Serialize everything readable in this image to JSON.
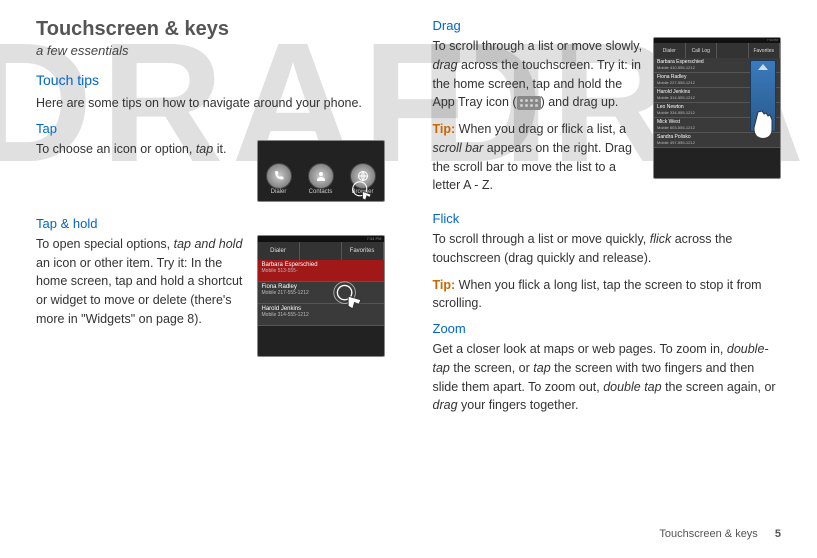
{
  "watermark": "DRAFT",
  "left": {
    "h1": "Touchscreen & keys",
    "subtitle": "a few essentials",
    "touch_tips_h": "Touch tips",
    "touch_tips_p": "Here are some tips on how to navigate around your phone.",
    "tap_h": "Tap",
    "tap_p1": "To choose an icon or option, ",
    "tap_p1_em": "tap",
    "tap_p1_end": " it.",
    "taphold_h": "Tap & hold",
    "taphold_p1a": "To open special options, ",
    "taphold_p1_em": "tap and hold",
    "taphold_p1b": " an icon or other item. Try it: In the home screen, tap and hold a shortcut or widget to move or delete (there's more in \"Widgets\" on page 8).",
    "fig_tap": {
      "i1": "Dialer",
      "i2": "Contacts",
      "i3": "Browser"
    },
    "fig_hold": {
      "tabs": [
        "Dialer",
        "",
        "Favorites"
      ],
      "r1": "Barbara Esperschied",
      "r1s": "Mobile 513-555-",
      "r2": "Fiona Radley",
      "r2s": "Mobile 217-555-1212",
      "r3": "Harold Jenkins",
      "r3s": "Mobile 314-555-1212"
    }
  },
  "right": {
    "drag_h": "Drag",
    "drag_p1a": "To scroll through a list or move slowly, ",
    "drag_p1_em": "drag",
    "drag_p1b": " across the touchscreen. Try it: in the home screen, tap and hold the App Tray icon (",
    "drag_p1c": ") and drag up.",
    "drag_tip": "Tip:",
    "drag_tip_a": " When you drag or flick a list, a ",
    "drag_tip_em": "scroll bar",
    "drag_tip_b": " appears on the right. Drag the scroll bar to move the list to a letter A - Z.",
    "flick_h": "Flick",
    "flick_p1a": "To scroll through a list or move quickly, ",
    "flick_p1_em": "flick",
    "flick_p1b": " across the touchscreen (drag quickly and release).",
    "flick_tip": "Tip:",
    "flick_tip_t": " When you flick a long list, tap the screen to stop it from scrolling.",
    "zoom_h": "Zoom",
    "zoom_p_a": "Get a closer look at maps or web pages. To zoom in, ",
    "zoom_em1": "double-tap",
    "zoom_p_b": " the screen, or ",
    "zoom_em2": "tap",
    "zoom_p_c": " the screen with two fingers and then slide them apart. To zoom out, ",
    "zoom_em3": "double tap",
    "zoom_p_d": " the screen again, or ",
    "zoom_em4": "drag",
    "zoom_p_e": " your fingers together.",
    "fig_drag": {
      "tabs": [
        "Dialer",
        "Call Log",
        "",
        "Favorites"
      ],
      "rows": [
        {
          "n": "Barbara Esperschied",
          "s": "Mobile 410-555-1212"
        },
        {
          "n": "Fiona Radley",
          "s": "Mobile 227-555-1212"
        },
        {
          "n": "Harold Jenkins",
          "s": "Mobile 314-555-1212"
        },
        {
          "n": "Leo Newton",
          "s": "Mobile 334-555-1212"
        },
        {
          "n": "Mick West",
          "s": "Mobile 603-555-1212"
        },
        {
          "n": "Sandra Polisko",
          "s": "Mobile 497-555-1212"
        }
      ]
    }
  },
  "footer": {
    "section": "Touchscreen & keys",
    "page": "5"
  }
}
